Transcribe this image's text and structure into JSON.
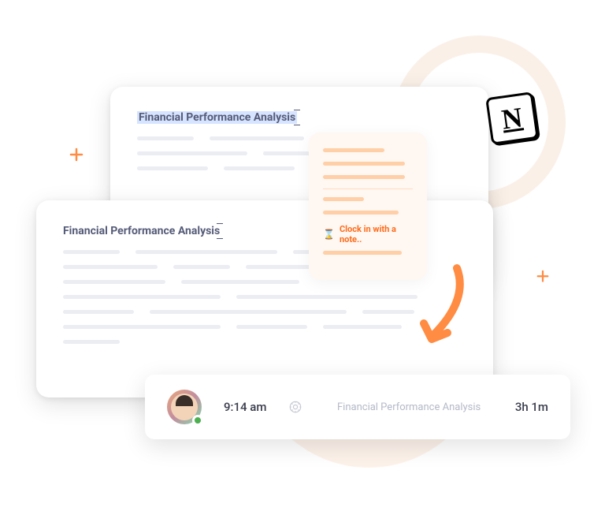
{
  "document": {
    "title": "Financial Performance Analysis"
  },
  "note_popup": {
    "action_label": "Clock in with a note.."
  },
  "timesheet": {
    "clock_in_time": "9:14 am",
    "task_name": "Financial Performance Analysis",
    "duration": "3h 1m"
  },
  "notion_badge": {
    "letter": "N"
  }
}
